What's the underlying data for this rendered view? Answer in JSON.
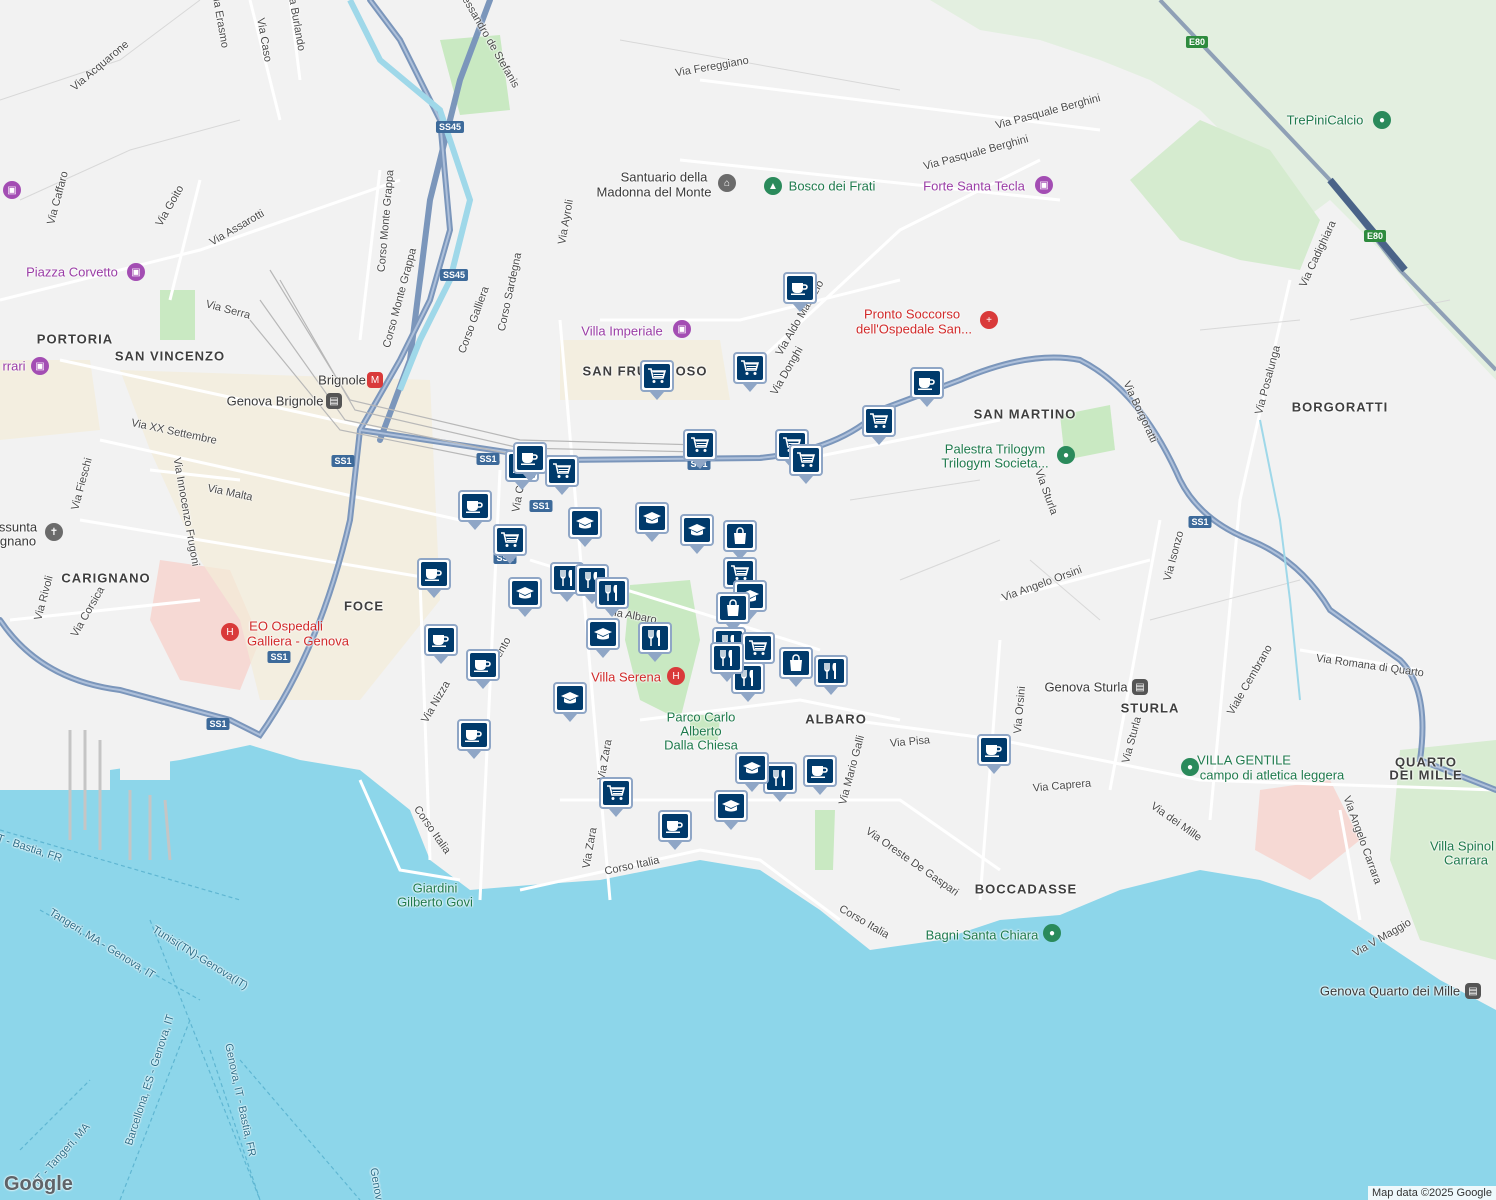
{
  "map": {
    "attribution": "Map data ©2025 Google",
    "logo": "Google",
    "colors": {
      "sea": "#8dd6ea",
      "land": "#f2f2f2",
      "park": "#c9e9c2",
      "highway": "#7b96bb",
      "marker_fill": "#003a6b",
      "marker_border": "#8fa6c6"
    }
  },
  "neighborhoods": [
    "PORTORIA",
    "SAN VINCENZO",
    "CARIGNANO",
    "FOCE",
    "ALBARO",
    "SAN MARTINO",
    "BORGORATTI",
    "STURLA",
    "QUARTO",
    "DEI MILLE",
    "BOCCADASSE",
    "SAN FRUTTUOSO"
  ],
  "streets": [
    "Via Acquarone",
    "Via Caffaro",
    "Via Goito",
    "Via Assarotti",
    "Corso Monte Grappa",
    "Via Serra",
    "Via XX Settembre",
    "Via Malta",
    "Via Fieschi",
    "Via Innocenzo Frugoni",
    "Via Rivoli",
    "Via Corsica",
    "Corso Galliera",
    "Corso Sardegna",
    "Via Ayroli",
    "Via Fereggiano",
    "Via Pasquale Berghini",
    "Via Pasquale Berghini",
    "Via Aldo Manuzio",
    "Via Donghi",
    "Via Borgoratti",
    "Via Posalunga",
    "Via Cadighiara",
    "Via Sturla",
    "Via Angelo Orsini",
    "Via Isonzo",
    "Via Romana di Quarto",
    "Viale Cembrano",
    "Via Sturla",
    "Via Pisa",
    "Via Mario Galli",
    "Via Caprera",
    "Via dei Mille",
    "Via Angelo Carrara",
    "Via V Maggio",
    "Via Oreste De Gaspari",
    "Corso Italia",
    "Corso Italia",
    "Corso Italia",
    "Via Zara",
    "Via Nizza",
    "Via Trento",
    "Via Orsini",
    "Corso Monte Grappa",
    "Via Burlando",
    "Via Caso",
    "Via Erasmo",
    "Via Caffa",
    "Via Albaro",
    "Via Zara",
    "Alessandro de Stefanis"
  ],
  "places": [
    {
      "name": "Piazza Corvetto",
      "kind": "purple"
    },
    {
      "name": "Villa Imperiale",
      "kind": "purple"
    },
    {
      "name": "Forte Santa Tecla",
      "kind": "purple"
    },
    {
      "name": "Santuario della",
      "kind": "gray"
    },
    {
      "name": "Madonna del Monte",
      "kind": "gray"
    },
    {
      "name": "Bosco dei Frati",
      "kind": "green"
    },
    {
      "name": "TrePiniCalcio",
      "kind": "green"
    },
    {
      "name": "Pronto Soccorso",
      "kind": "red"
    },
    {
      "name": "dell'Ospedale San...",
      "kind": "red"
    },
    {
      "name": "Palestra Trilogym",
      "kind": "green"
    },
    {
      "name": "Trilogym Societa...",
      "kind": "green"
    },
    {
      "name": "Brignole",
      "kind": "gray"
    },
    {
      "name": "Genova Brignole",
      "kind": "gray"
    },
    {
      "name": "EO Ospedali",
      "kind": "red"
    },
    {
      "name": "Galliera - Genova",
      "kind": "red"
    },
    {
      "name": "Villa Serena",
      "kind": "red"
    },
    {
      "name": "Parco Carlo",
      "kind": "green"
    },
    {
      "name": "Alberto",
      "kind": "green"
    },
    {
      "name": "Dalla Chiesa",
      "kind": "green"
    },
    {
      "name": "Genova Sturla",
      "kind": "gray"
    },
    {
      "name": "VILLA GENTILE",
      "kind": "green"
    },
    {
      "name": "campo di atletica leggera",
      "kind": "green"
    },
    {
      "name": "Bagni Santa Chiara",
      "kind": "green"
    },
    {
      "name": "Genova Quarto dei Mille",
      "kind": "gray"
    },
    {
      "name": "Villa Spinol",
      "kind": "green"
    },
    {
      "name": "Carrara",
      "kind": "green"
    },
    {
      "name": "Giardini",
      "kind": "green"
    },
    {
      "name": "Gilberto Govi",
      "kind": "green"
    },
    {
      "name": "ssunta",
      "kind": "gray"
    },
    {
      "name": "gnano",
      "kind": "gray"
    },
    {
      "name": "rrari",
      "kind": "purple"
    }
  ],
  "sea_routes": [
    "IT - Bastia, FR",
    "Tangeri, MA - Genova, IT",
    "Tunisi(TN)-Genova(IT)",
    "Barcellona, ES - Genova, IT",
    "Genova, IT - Bastia, FR",
    "IT - Tangeri, MA",
    "Genov"
  ],
  "road_shields": [
    "SS45",
    "SS45",
    "SS1",
    "SS1",
    "SS1",
    "SS1",
    "SS1",
    "SS1",
    "SS1",
    "SS1",
    "E80",
    "E80"
  ],
  "markers": [
    {
      "type": "cafe"
    },
    {
      "type": "grocery"
    },
    {
      "type": "grocery"
    },
    {
      "type": "cafe"
    },
    {
      "type": "grocery"
    },
    {
      "type": "grocery"
    },
    {
      "type": "grocery"
    },
    {
      "type": "grocery"
    },
    {
      "type": "cafe"
    },
    {
      "type": "grocery"
    },
    {
      "type": "cafe"
    },
    {
      "type": "cafe"
    },
    {
      "type": "grocery"
    },
    {
      "type": "school"
    },
    {
      "type": "school"
    },
    {
      "type": "school"
    },
    {
      "type": "shopping"
    },
    {
      "type": "school"
    },
    {
      "type": "cafe"
    },
    {
      "type": "restaurant"
    },
    {
      "type": "restaurant"
    },
    {
      "type": "restaurant"
    },
    {
      "type": "grocery"
    },
    {
      "type": "school"
    },
    {
      "type": "shopping"
    },
    {
      "type": "school"
    },
    {
      "type": "restaurant"
    },
    {
      "type": "cafe"
    },
    {
      "type": "cafe"
    },
    {
      "type": "restaurant"
    },
    {
      "type": "grocery"
    },
    {
      "type": "restaurant"
    },
    {
      "type": "shopping"
    },
    {
      "type": "restaurant"
    },
    {
      "type": "restaurant"
    },
    {
      "type": "school"
    },
    {
      "type": "cafe"
    },
    {
      "type": "school"
    },
    {
      "type": "restaurant"
    },
    {
      "type": "cafe"
    },
    {
      "type": "grocery"
    },
    {
      "type": "school"
    },
    {
      "type": "cafe"
    },
    {
      "type": "cafe"
    }
  ]
}
